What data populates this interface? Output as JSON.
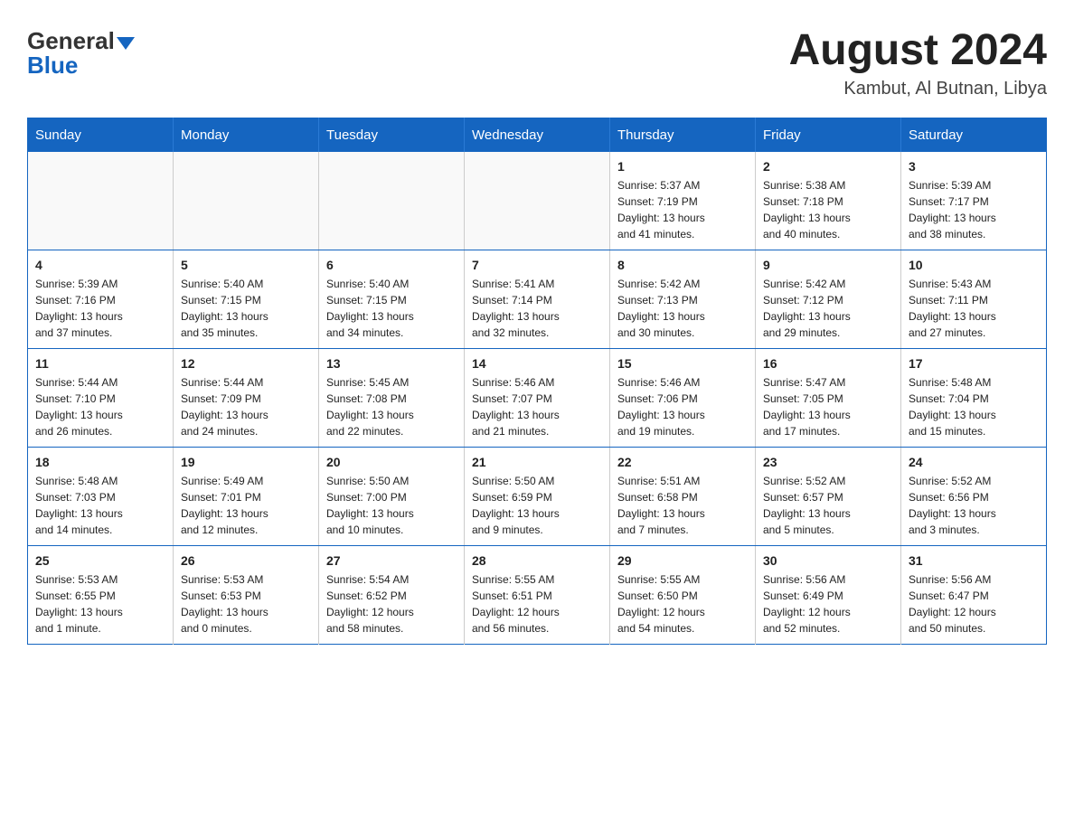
{
  "header": {
    "logo_general": "General",
    "logo_blue": "Blue",
    "month_title": "August 2024",
    "location": "Kambut, Al Butnan, Libya"
  },
  "days_of_week": [
    "Sunday",
    "Monday",
    "Tuesday",
    "Wednesday",
    "Thursday",
    "Friday",
    "Saturday"
  ],
  "weeks": [
    {
      "days": [
        {
          "number": "",
          "info": ""
        },
        {
          "number": "",
          "info": ""
        },
        {
          "number": "",
          "info": ""
        },
        {
          "number": "",
          "info": ""
        },
        {
          "number": "1",
          "info": "Sunrise: 5:37 AM\nSunset: 7:19 PM\nDaylight: 13 hours\nand 41 minutes."
        },
        {
          "number": "2",
          "info": "Sunrise: 5:38 AM\nSunset: 7:18 PM\nDaylight: 13 hours\nand 40 minutes."
        },
        {
          "number": "3",
          "info": "Sunrise: 5:39 AM\nSunset: 7:17 PM\nDaylight: 13 hours\nand 38 minutes."
        }
      ]
    },
    {
      "days": [
        {
          "number": "4",
          "info": "Sunrise: 5:39 AM\nSunset: 7:16 PM\nDaylight: 13 hours\nand 37 minutes."
        },
        {
          "number": "5",
          "info": "Sunrise: 5:40 AM\nSunset: 7:15 PM\nDaylight: 13 hours\nand 35 minutes."
        },
        {
          "number": "6",
          "info": "Sunrise: 5:40 AM\nSunset: 7:15 PM\nDaylight: 13 hours\nand 34 minutes."
        },
        {
          "number": "7",
          "info": "Sunrise: 5:41 AM\nSunset: 7:14 PM\nDaylight: 13 hours\nand 32 minutes."
        },
        {
          "number": "8",
          "info": "Sunrise: 5:42 AM\nSunset: 7:13 PM\nDaylight: 13 hours\nand 30 minutes."
        },
        {
          "number": "9",
          "info": "Sunrise: 5:42 AM\nSunset: 7:12 PM\nDaylight: 13 hours\nand 29 minutes."
        },
        {
          "number": "10",
          "info": "Sunrise: 5:43 AM\nSunset: 7:11 PM\nDaylight: 13 hours\nand 27 minutes."
        }
      ]
    },
    {
      "days": [
        {
          "number": "11",
          "info": "Sunrise: 5:44 AM\nSunset: 7:10 PM\nDaylight: 13 hours\nand 26 minutes."
        },
        {
          "number": "12",
          "info": "Sunrise: 5:44 AM\nSunset: 7:09 PM\nDaylight: 13 hours\nand 24 minutes."
        },
        {
          "number": "13",
          "info": "Sunrise: 5:45 AM\nSunset: 7:08 PM\nDaylight: 13 hours\nand 22 minutes."
        },
        {
          "number": "14",
          "info": "Sunrise: 5:46 AM\nSunset: 7:07 PM\nDaylight: 13 hours\nand 21 minutes."
        },
        {
          "number": "15",
          "info": "Sunrise: 5:46 AM\nSunset: 7:06 PM\nDaylight: 13 hours\nand 19 minutes."
        },
        {
          "number": "16",
          "info": "Sunrise: 5:47 AM\nSunset: 7:05 PM\nDaylight: 13 hours\nand 17 minutes."
        },
        {
          "number": "17",
          "info": "Sunrise: 5:48 AM\nSunset: 7:04 PM\nDaylight: 13 hours\nand 15 minutes."
        }
      ]
    },
    {
      "days": [
        {
          "number": "18",
          "info": "Sunrise: 5:48 AM\nSunset: 7:03 PM\nDaylight: 13 hours\nand 14 minutes."
        },
        {
          "number": "19",
          "info": "Sunrise: 5:49 AM\nSunset: 7:01 PM\nDaylight: 13 hours\nand 12 minutes."
        },
        {
          "number": "20",
          "info": "Sunrise: 5:50 AM\nSunset: 7:00 PM\nDaylight: 13 hours\nand 10 minutes."
        },
        {
          "number": "21",
          "info": "Sunrise: 5:50 AM\nSunset: 6:59 PM\nDaylight: 13 hours\nand 9 minutes."
        },
        {
          "number": "22",
          "info": "Sunrise: 5:51 AM\nSunset: 6:58 PM\nDaylight: 13 hours\nand 7 minutes."
        },
        {
          "number": "23",
          "info": "Sunrise: 5:52 AM\nSunset: 6:57 PM\nDaylight: 13 hours\nand 5 minutes."
        },
        {
          "number": "24",
          "info": "Sunrise: 5:52 AM\nSunset: 6:56 PM\nDaylight: 13 hours\nand 3 minutes."
        }
      ]
    },
    {
      "days": [
        {
          "number": "25",
          "info": "Sunrise: 5:53 AM\nSunset: 6:55 PM\nDaylight: 13 hours\nand 1 minute."
        },
        {
          "number": "26",
          "info": "Sunrise: 5:53 AM\nSunset: 6:53 PM\nDaylight: 13 hours\nand 0 minutes."
        },
        {
          "number": "27",
          "info": "Sunrise: 5:54 AM\nSunset: 6:52 PM\nDaylight: 12 hours\nand 58 minutes."
        },
        {
          "number": "28",
          "info": "Sunrise: 5:55 AM\nSunset: 6:51 PM\nDaylight: 12 hours\nand 56 minutes."
        },
        {
          "number": "29",
          "info": "Sunrise: 5:55 AM\nSunset: 6:50 PM\nDaylight: 12 hours\nand 54 minutes."
        },
        {
          "number": "30",
          "info": "Sunrise: 5:56 AM\nSunset: 6:49 PM\nDaylight: 12 hours\nand 52 minutes."
        },
        {
          "number": "31",
          "info": "Sunrise: 5:56 AM\nSunset: 6:47 PM\nDaylight: 12 hours\nand 50 minutes."
        }
      ]
    }
  ]
}
